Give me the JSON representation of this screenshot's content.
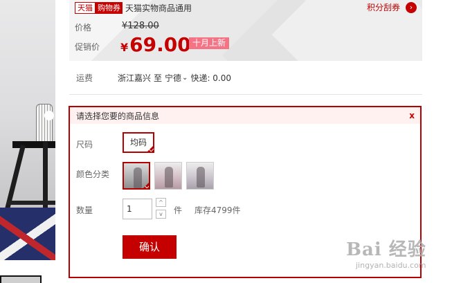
{
  "coupon": {
    "tmall_badge": "天猫",
    "coupon_badge": "购物券",
    "text": "天猫实物商品通用",
    "points_link": "积分刮券",
    "go_icon": "›"
  },
  "price": {
    "label": "价格",
    "currency": "¥",
    "original": "128.00",
    "promo_label": "促销价",
    "promo_value": "69.00",
    "promo_tag": "十月上新"
  },
  "shipping": {
    "label": "运费",
    "from": "浙江嘉兴",
    "to_prefix": "至",
    "to": "宁德",
    "arrow": "⌄",
    "fee": "快递: 0.00"
  },
  "panel": {
    "title": "请选择您要的商品信息",
    "close": "x",
    "size_label": "尺码",
    "size_option": "均码",
    "color_label": "颜色分类",
    "qty_label": "数量",
    "qty_value": "1",
    "step_up": "^",
    "step_down": "v",
    "unit": "件",
    "stock": "库存4799件",
    "confirm": "确认"
  },
  "watermark": {
    "brand": "Bai  经验",
    "url": "jingyan.baidu.com"
  }
}
